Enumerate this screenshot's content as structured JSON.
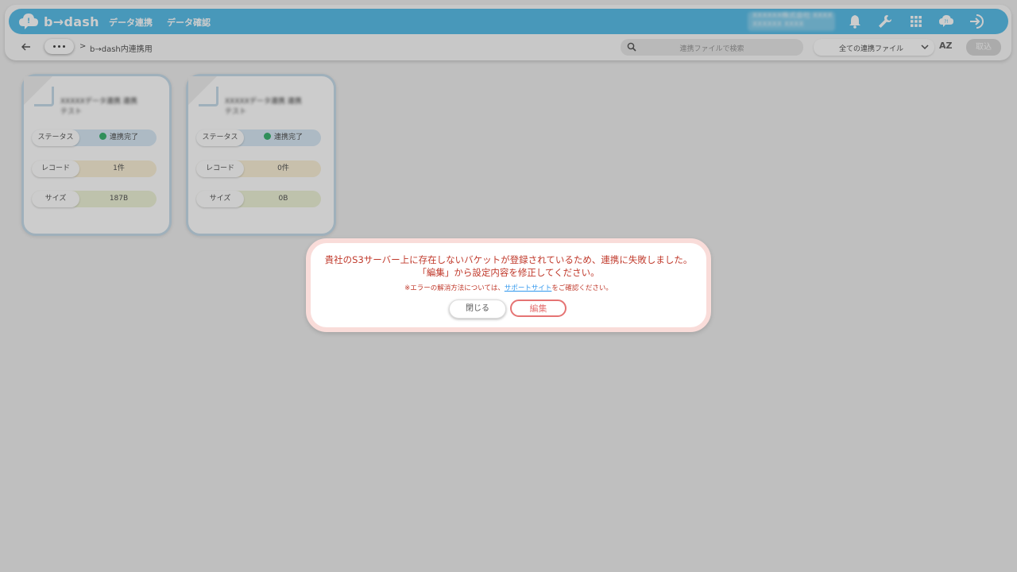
{
  "header": {
    "logo_text": "b→dash",
    "nav": [
      "データ連携",
      "データ確認"
    ],
    "user_lines": [
      "XXXXXX株式会社 XXXX",
      "XXXXXX XXXX"
    ],
    "icons": [
      "bell-icon",
      "wrench-icon",
      "grid-icon",
      "help-chat-icon",
      "logout-icon"
    ],
    "accent_color": "#5bbfe9"
  },
  "toolbar": {
    "breadcrumb_sep": ">",
    "breadcrumb": "b→dash内連携用",
    "search_placeholder": "連携ファイルで検索",
    "filter_value": "全ての連携ファイル",
    "sort_label": "AZ",
    "import_label": "取込"
  },
  "cards": [
    {
      "name": "XXXXXデータ連携 連携テスト",
      "status_label": "ステータス",
      "status_value": "連携完了",
      "record_label": "レコード",
      "record_value": "1件",
      "size_label": "サイズ",
      "size_value": "187B"
    },
    {
      "name": "XXXXXデータ連携 連携テスト",
      "status_label": "ステータス",
      "status_value": "連携完了",
      "record_label": "レコード",
      "record_value": "0件",
      "size_label": "サイズ",
      "size_value": "0B"
    }
  ],
  "dialog": {
    "message1": "貴社のS3サーバー上に存在しないバケットが登録されているため、連携に失敗しました。",
    "message2": "「編集」から設定内容を修正してください。",
    "note_prefix": "※エラーの解消方法については、",
    "note_link": "サポートサイト",
    "note_suffix": "をご確認ください。",
    "close_label": "閉じる",
    "edit_label": "編集"
  }
}
